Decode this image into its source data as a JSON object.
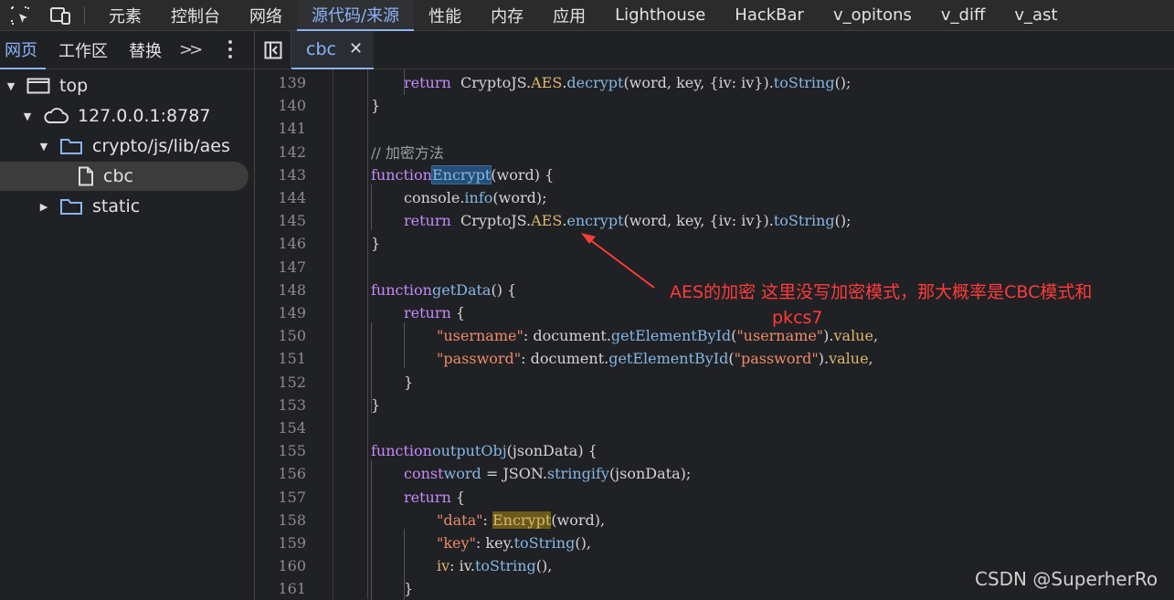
{
  "devtools_tabs": [
    "元素",
    "控制台",
    "网络",
    "源代码/来源",
    "性能",
    "内存",
    "应用",
    "Lighthouse",
    "HackBar",
    "v_opitons",
    "v_diff",
    "v_ast"
  ],
  "active_devtools_tab": "源代码/来源",
  "navigator": {
    "tabs": [
      "网页",
      "工作区",
      "替换"
    ],
    "tree": [
      {
        "label": "top",
        "icon": "frame-icon",
        "expanded": true,
        "depth": 0
      },
      {
        "label": "127.0.0.1:8787",
        "icon": "cloud-icon",
        "expanded": true,
        "depth": 1
      },
      {
        "label": "crypto/js/lib/aes",
        "icon": "folder-icon",
        "expanded": true,
        "depth": 2
      },
      {
        "label": "cbc",
        "icon": "file-icon",
        "selected": true,
        "depth": 3
      },
      {
        "label": "static",
        "icon": "folder-icon",
        "expanded": false,
        "depth": 2
      }
    ]
  },
  "editor": {
    "file_tab": "cbc",
    "line_numbers": [
      "139",
      "140",
      "141",
      "142",
      "143",
      "144",
      "145",
      "146",
      "147",
      "148",
      "149",
      "150",
      "151",
      "152",
      "153",
      "154",
      "155",
      "156",
      "157",
      "158",
      "159",
      "160",
      "161"
    ]
  },
  "annotation": {
    "text_line1": "AES的加密  这里没写加密模式，那大概率是CBC模式和",
    "text_line2": "pkcs7",
    "color": "#ff3b3b"
  },
  "watermark": "CSDN @SuperherRo",
  "colors": {
    "accent": "#8ab4f8",
    "keyword": "#c58af9",
    "function": "#84b7e5",
    "property": "#ddb76b",
    "string": "#ee8b68",
    "comment": "#9aa0a6"
  }
}
